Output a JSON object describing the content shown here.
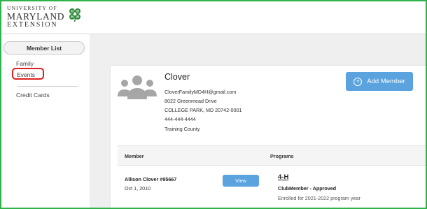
{
  "brand": {
    "line1": "UNIVERSITY OF",
    "line2": "MARYLAND",
    "line3": "EXTENSION",
    "logo_icon": "four-leaf-clover-icon",
    "logo_color": "#2e8b3a"
  },
  "sidebar": {
    "tab_label": "Member List",
    "items": [
      {
        "label": "Family"
      },
      {
        "label": "Events"
      },
      {
        "label": "Credit Cards"
      }
    ]
  },
  "family": {
    "name": "Clover",
    "email": "CloverFamilyMD4H@gmail.com",
    "address_line1": "8022 Greenmead Drive",
    "address_line2": "COLLEGE PARK, MD 20742-0001",
    "phone": "444-444-4444",
    "county": "Training County",
    "avatar_icon": "family-group-icon"
  },
  "actions": {
    "add_member_label": "Add Member",
    "add_member_icon": "plus-circle-icon",
    "button_color": "#5aa3df"
  },
  "table": {
    "columns": [
      "Member",
      "Programs"
    ],
    "rows": [
      {
        "member_name": "Allison Clover #95667",
        "birth_date": "Oct 1, 2010",
        "view_label": "View",
        "program": "4-H",
        "status": "ClubMember - Approved",
        "enrolled": "Enrolled for 2021-2022 program year"
      }
    ]
  },
  "highlight_color": "#e02020",
  "frame_color": "#2fb24a"
}
